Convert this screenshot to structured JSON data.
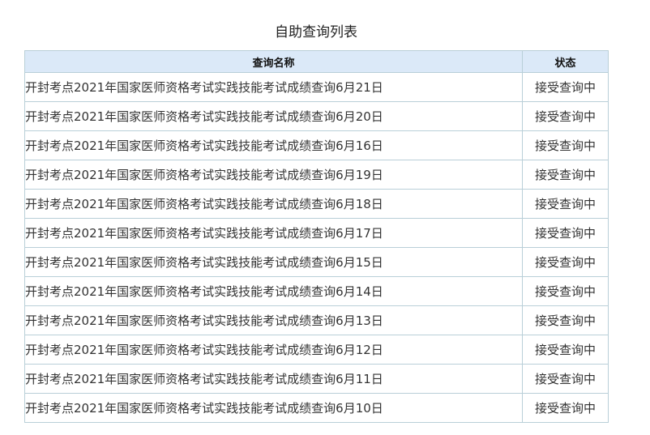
{
  "page": {
    "title": "自助查询列表"
  },
  "table": {
    "headers": {
      "name": "查询名称",
      "status": "状态"
    },
    "rows": [
      {
        "name": "开封考点2021年国家医师资格考试实践技能考试成绩查询6月21日",
        "status": "接受查询中"
      },
      {
        "name": "开封考点2021年国家医师资格考试实践技能考试成绩查询6月20日",
        "status": "接受查询中"
      },
      {
        "name": "开封考点2021年国家医师资格考试实践技能考试成绩查询6月16日",
        "status": "接受查询中"
      },
      {
        "name": "开封考点2021年国家医师资格考试实践技能考试成绩查询6月19日",
        "status": "接受查询中"
      },
      {
        "name": "开封考点2021年国家医师资格考试实践技能考试成绩查询6月18日",
        "status": "接受查询中"
      },
      {
        "name": "开封考点2021年国家医师资格考试实践技能考试成绩查询6月17日",
        "status": "接受查询中"
      },
      {
        "name": "开封考点2021年国家医师资格考试实践技能考试成绩查询6月15日",
        "status": "接受查询中"
      },
      {
        "name": "开封考点2021年国家医师资格考试实践技能考试成绩查询6月14日",
        "status": "接受查询中"
      },
      {
        "name": "开封考点2021年国家医师资格考试实践技能考试成绩查询6月13日",
        "status": "接受查询中"
      },
      {
        "name": "开封考点2021年国家医师资格考试实践技能考试成绩查询6月12日",
        "status": "接受查询中"
      },
      {
        "name": "开封考点2021年国家医师资格考试实践技能考试成绩查询6月11日",
        "status": "接受查询中"
      },
      {
        "name": "开封考点2021年国家医师资格考试实践技能考试成绩查询6月10日",
        "status": "接受查询中"
      }
    ]
  }
}
